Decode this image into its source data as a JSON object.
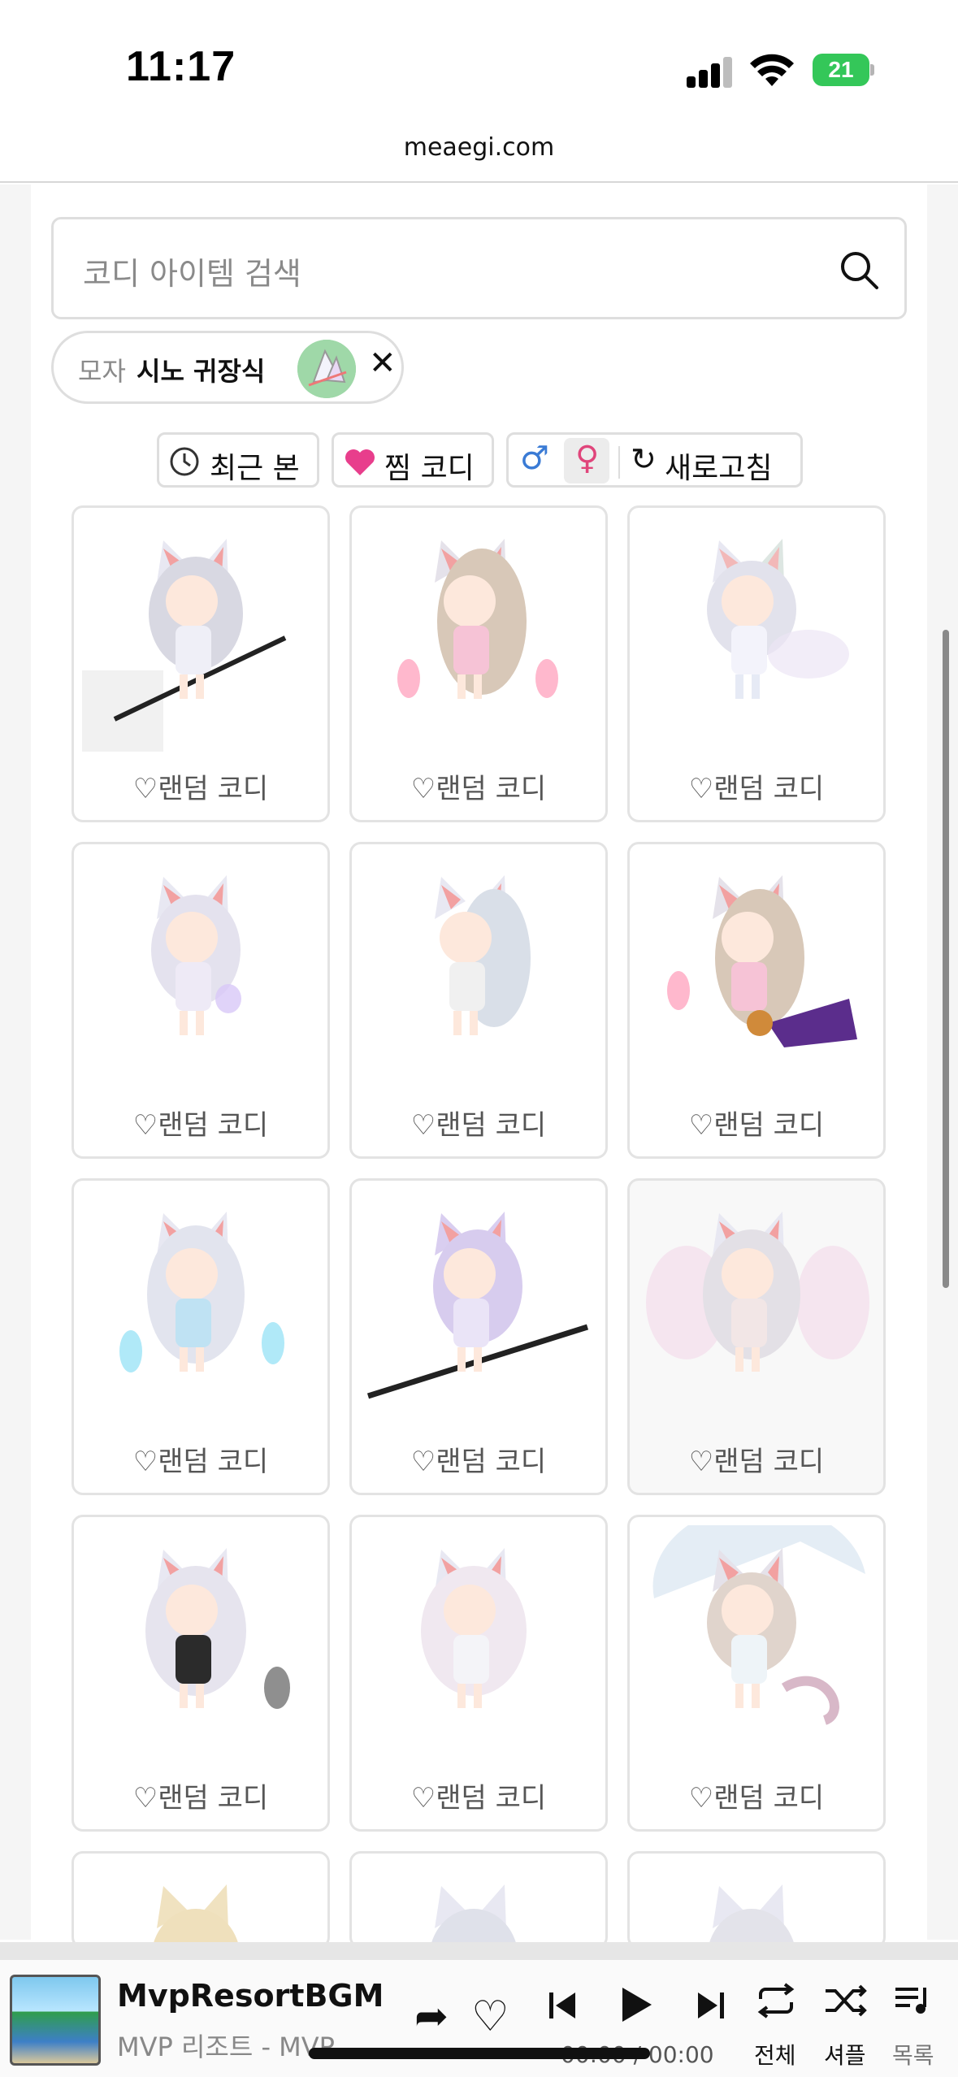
{
  "status": {
    "time": "11:17",
    "battery": "21"
  },
  "browser": {
    "url": "meaegi.com"
  },
  "search": {
    "placeholder": "코디 아이템 검색"
  },
  "chip": {
    "category": "모자",
    "item": "시노 귀장식"
  },
  "filters": {
    "recent": "최근 본",
    "wishlist": "찜 코디",
    "male_symbol": "♂",
    "female_symbol": "♀",
    "refresh": "새로고침"
  },
  "cards": [
    {
      "label": "랜덤 코디"
    },
    {
      "label": "랜덤 코디"
    },
    {
      "label": "랜덤 코디"
    },
    {
      "label": "랜덤 코디"
    },
    {
      "label": "랜덤 코디"
    },
    {
      "label": "랜덤 코디"
    },
    {
      "label": "랜덤 코디"
    },
    {
      "label": "랜덤 코디"
    },
    {
      "label": "랜덤 코디"
    },
    {
      "label": "랜덤 코디"
    },
    {
      "label": "랜덤 코디"
    },
    {
      "label": "랜덤 코디"
    }
  ],
  "player": {
    "title": "MvpResortBGM",
    "subtitle": "MVP 리조트 - MVP",
    "time": "00:00 / 00:00",
    "all_label": "전체",
    "shuffle_label": "셔플",
    "list_label": "목록"
  },
  "colors": {
    "male": "#3a7bd5",
    "female": "#e0457b",
    "heart": "#e83e8c"
  }
}
